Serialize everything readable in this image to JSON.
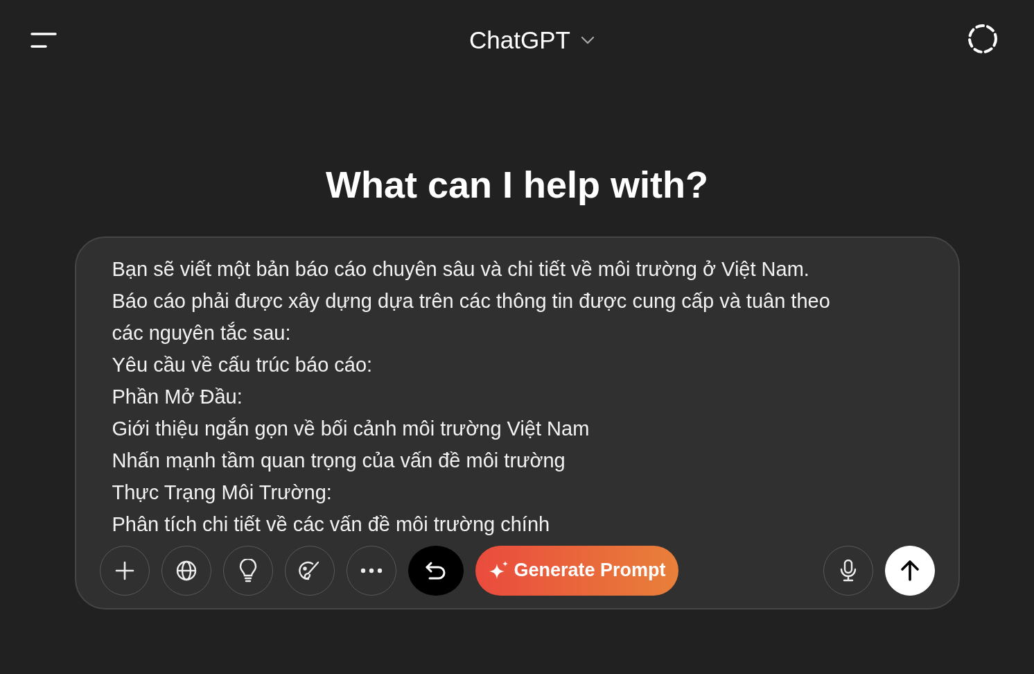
{
  "header": {
    "title": "ChatGPT"
  },
  "heading": "What can I help with?",
  "composer": {
    "lines": [
      "Bạn sẽ viết một bản báo cáo chuyên sâu và chi tiết về môi trường ở Việt Nam.",
      "Báo cáo phải được xây dựng dựa trên các thông tin được cung cấp và tuân theo các nguyên tắc sau:",
      "Yêu cầu về cấu trúc báo cáo:",
      "Phần Mở Đầu:",
      "Giới thiệu ngắn gọn về bối cảnh môi trường Việt Nam",
      "Nhấn mạnh tầm quan trọng của vấn đề môi trường",
      "Thực Trạng Môi Trường:",
      "Phân tích chi tiết về các vấn đề môi trường chính"
    ],
    "tools": [
      {
        "kind": "plus"
      },
      {
        "kind": "globe"
      },
      {
        "kind": "bulb"
      },
      {
        "kind": "brush"
      },
      {
        "kind": "more"
      },
      {
        "kind": "undo"
      }
    ],
    "generate_button": "Generate Prompt"
  }
}
